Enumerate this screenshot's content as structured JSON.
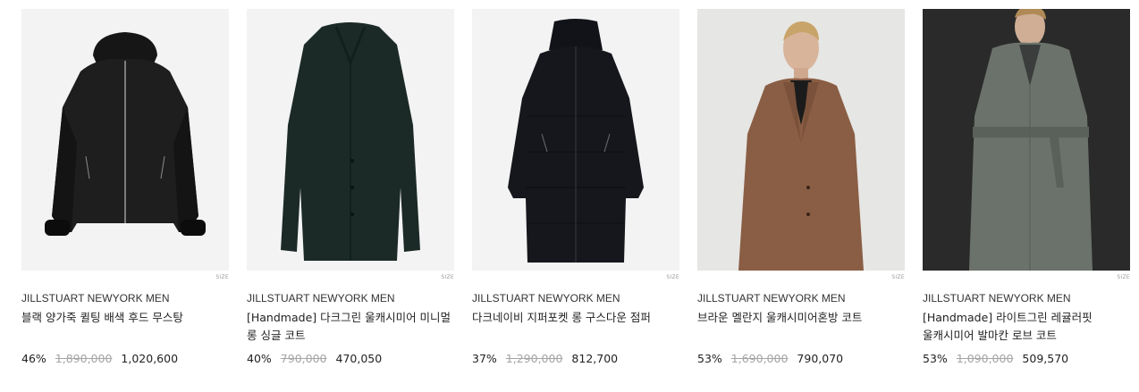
{
  "products": [
    {
      "brand": "JILLSTUART NEWYORK MEN",
      "name": "블랙 양가죽 퀼팅 배색 후드 무스탕",
      "discount": "46%",
      "original_price": "1,890,000",
      "sale_price": "1,020,600",
      "size_label": "SIZE",
      "image_icon": "black-hooded-shearling-jacket"
    },
    {
      "brand": "JILLSTUART NEWYORK MEN",
      "name": "[Handmade] 다크그린 울캐시미어 미니멀 롱 싱글 코트",
      "discount": "40%",
      "original_price": "790,000",
      "sale_price": "470,050",
      "size_label": "SIZE",
      "image_icon": "dark-green-long-coat"
    },
    {
      "brand": "JILLSTUART NEWYORK MEN",
      "name": "다크네이비 지퍼포켓 롱 구스다운 점퍼",
      "discount": "37%",
      "original_price": "1,290,000",
      "sale_price": "812,700",
      "size_label": "SIZE",
      "image_icon": "navy-long-down-jumper"
    },
    {
      "brand": "JILLSTUART NEWYORK MEN",
      "name": "브라운 멜란지 울캐시미어혼방 코트",
      "discount": "53%",
      "original_price": "1,690,000",
      "sale_price": "790,070",
      "size_label": "SIZE",
      "image_icon": "brown-melange-coat-model"
    },
    {
      "brand": "JILLSTUART NEWYORK MEN",
      "name": "[Handmade] 라이트그린 레귤러핏 울캐시미어 발마칸 로브 코트",
      "discount": "53%",
      "original_price": "1,090,000",
      "sale_price": "509,570",
      "size_label": "SIZE",
      "image_icon": "light-green-robe-coat-model"
    }
  ],
  "colors": {
    "text": "#222222",
    "strikethrough": "#a5a5a5",
    "size_tag": "#9a9a9a"
  }
}
